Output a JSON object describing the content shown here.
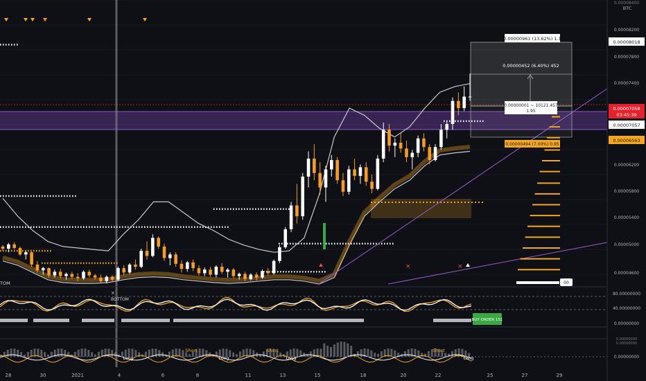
{
  "header": {
    "symbol": "BTC",
    "top_price": "0.00008400"
  },
  "colors": {
    "background": "#0f1015",
    "bull": "#ffffff",
    "bear": "#f39c2b",
    "orange": "#f5a623",
    "purple_zone": "#6b3fa0",
    "price_red": "#e5212b",
    "green": "#3aa845",
    "grid": "#1b1d24"
  },
  "price_axis": {
    "ticks": [
      "0.00008200",
      "0.00007800",
      "0.00007400",
      "0.00006200",
      "0.00005800",
      "0.00005400",
      "0.00005000",
      "0.00004600"
    ],
    "labels": {
      "high": "0.00008018",
      "current": "0.00007058",
      "countdown": "03:45:39",
      "level": "0.00007057",
      "entry": "0.00006563"
    }
  },
  "time_axis": [
    "28",
    "30",
    "2021",
    "4",
    "6",
    "8",
    "11",
    "13",
    "15",
    "18",
    "20",
    "22",
    "25",
    "27",
    "29"
  ],
  "annotations": {
    "measure_top": "0.00000961 (13.62%) 1.1",
    "measure_mid": "0.00000452 (6.40%) 452",
    "measure_cur_line1": "0.00000001 ~ 10121.457",
    "measure_cur_line2": "1.95",
    "measure_low": "0.00000494 (7.00%) 0.95",
    "bottom_left": "TOM",
    "bottom_label": "BOTTOM",
    "buy_order": "BUY ORDER 151",
    "right_small": "00"
  },
  "osc_panel": {
    "ticks": [
      "80.00000000",
      "40.00000000",
      "0.00000000"
    ]
  },
  "vol_panel": {
    "ticks": [
      "0.00000000"
    ],
    "short_labels": [
      "Short",
      "Short",
      "Short"
    ],
    "long_labels": [
      "Long",
      "Long",
      "Long",
      "Long"
    ]
  },
  "chart_data": {
    "type": "candlestick",
    "symbol": "BTC",
    "candles": [
      [
        4.98e-05,
        5e-05,
        4.92e-05,
        4.95e-05
      ],
      [
        4.95e-05,
        5.03e-05,
        4.9e-05,
        5.01e-05
      ],
      [
        5.01e-05,
        5.04e-05,
        4.94e-05,
        4.96e-05
      ],
      [
        4.96e-05,
        4.98e-05,
        4.85e-05,
        4.87e-05
      ],
      [
        4.87e-05,
        4.92e-05,
        4.8e-05,
        4.9e-05
      ],
      [
        4.9e-05,
        4.91e-05,
        4.7e-05,
        4.73e-05
      ],
      [
        4.73e-05,
        4.78e-05,
        4.62e-05,
        4.65e-05
      ],
      [
        4.65e-05,
        4.7e-05,
        4.59e-05,
        4.68e-05
      ],
      [
        4.68e-05,
        4.69e-05,
        4.55e-05,
        4.58e-05
      ],
      [
        4.58e-05,
        4.66e-05,
        4.55e-05,
        4.63e-05
      ],
      [
        4.63e-05,
        4.67e-05,
        4.54e-05,
        4.57e-05
      ],
      [
        4.57e-05,
        4.62e-05,
        4.52e-05,
        4.6e-05
      ],
      [
        4.6e-05,
        4.63e-05,
        4.53e-05,
        4.56e-05
      ],
      [
        4.56e-05,
        4.61e-05,
        4.5e-05,
        4.54e-05
      ],
      [
        4.54e-05,
        4.65e-05,
        4.52e-05,
        4.63e-05
      ],
      [
        4.63e-05,
        4.66e-05,
        4.55e-05,
        4.58e-05
      ],
      [
        4.58e-05,
        4.6e-05,
        4.52e-05,
        4.55e-05
      ],
      [
        4.55e-05,
        4.59e-05,
        4.48e-05,
        4.5e-05
      ],
      [
        4.5e-05,
        4.58e-05,
        4.47e-05,
        4.56e-05
      ],
      [
        4.56e-05,
        4.58e-05,
        4.49e-05,
        4.52e-05
      ],
      [
        4.52e-05,
        4.7e-05,
        4.5e-05,
        4.68e-05
      ],
      [
        4.68e-05,
        4.72e-05,
        4.58e-05,
        4.62e-05
      ],
      [
        4.62e-05,
        4.75e-05,
        4.6e-05,
        4.73e-05
      ],
      [
        4.73e-05,
        4.8e-05,
        4.66e-05,
        4.7e-05
      ],
      [
        4.7e-05,
        4.95e-05,
        4.68e-05,
        4.92e-05
      ],
      [
        4.92e-05,
        5.05e-05,
        4.8e-05,
        4.85e-05
      ],
      [
        4.85e-05,
        5.15e-05,
        4.83e-05,
        5.1e-05
      ],
      [
        5.1e-05,
        5.12e-05,
        4.95e-05,
        4.98e-05
      ],
      [
        4.98e-05,
        5.02e-05,
        4.78e-05,
        4.82e-05
      ],
      [
        4.82e-05,
        4.9e-05,
        4.72e-05,
        4.87e-05
      ],
      [
        4.87e-05,
        4.9e-05,
        4.7e-05,
        4.74e-05
      ],
      [
        4.74e-05,
        4.79e-05,
        4.62e-05,
        4.67e-05
      ],
      [
        4.67e-05,
        4.78e-05,
        4.63e-05,
        4.76e-05
      ],
      [
        4.76e-05,
        4.8e-05,
        4.64e-05,
        4.68e-05
      ],
      [
        4.68e-05,
        4.72e-05,
        4.58e-05,
        4.61e-05
      ],
      [
        4.61e-05,
        4.69e-05,
        4.57e-05,
        4.66e-05
      ],
      [
        4.66e-05,
        4.7e-05,
        4.56e-05,
        4.59e-05
      ],
      [
        4.59e-05,
        4.72e-05,
        4.55e-05,
        4.7e-05
      ],
      [
        4.7e-05,
        4.75e-05,
        4.6e-05,
        4.63e-05
      ],
      [
        4.63e-05,
        4.68e-05,
        4.55e-05,
        4.66e-05
      ],
      [
        4.66e-05,
        4.68e-05,
        4.54e-05,
        4.57e-05
      ],
      [
        4.57e-05,
        4.62e-05,
        4.52e-05,
        4.6e-05
      ],
      [
        4.6e-05,
        4.63e-05,
        4.5e-05,
        4.53e-05
      ],
      [
        4.53e-05,
        4.61e-05,
        4.51e-05,
        4.59e-05
      ],
      [
        4.59e-05,
        4.62e-05,
        4.51e-05,
        4.55e-05
      ],
      [
        4.55e-05,
        4.66e-05,
        4.53e-05,
        4.64e-05
      ],
      [
        4.64e-05,
        4.68e-05,
        4.58e-05,
        4.61e-05
      ],
      [
        4.61e-05,
        4.8e-05,
        4.59e-05,
        4.78e-05
      ],
      [
        4.78e-05,
        5e-05,
        4.75e-05,
        4.97e-05
      ],
      [
        4.97e-05,
        5.25e-05,
        4.95e-05,
        5.22e-05
      ],
      [
        5.22e-05,
        5.6e-05,
        5.18e-05,
        5.55e-05
      ],
      [
        5.55e-05,
        5.85e-05,
        5.3e-05,
        5.4e-05
      ],
      [
        5.4e-05,
        6e-05,
        5.35e-05,
        5.95e-05
      ],
      [
        5.95e-05,
        6.3e-05,
        5.8e-05,
        6.2e-05
      ],
      [
        6.2e-05,
        6.4e-05,
        5.9e-05,
        6e-05
      ],
      [
        6e-05,
        6.15e-05,
        5.7e-05,
        5.8e-05
      ],
      [
        5.8e-05,
        6.1e-05,
        5.6e-05,
        6.05e-05
      ],
      [
        6.05e-05,
        6.25e-05,
        5.95e-05,
        6.18e-05
      ],
      [
        6.18e-05,
        6.22e-05,
        5.85e-05,
        5.9e-05
      ],
      [
        5.9e-05,
        6e-05,
        5.68e-05,
        5.74e-05
      ],
      [
        5.74e-05,
        6.1e-05,
        5.7e-05,
        6.05e-05
      ],
      [
        6.05e-05,
        6.2e-05,
        5.9e-05,
        5.96e-05
      ],
      [
        5.96e-05,
        6.12e-05,
        5.85e-05,
        6.08e-05
      ],
      [
        6.08e-05,
        6.15e-05,
        5.82e-05,
        5.88e-05
      ],
      [
        5.88e-05,
        5.98e-05,
        5.72e-05,
        5.78e-05
      ],
      [
        5.78e-05,
        6.25e-05,
        5.76e-05,
        6.2e-05
      ],
      [
        6.2e-05,
        6.7e-05,
        6.15e-05,
        6.6e-05
      ],
      [
        6.6e-05,
        6.68e-05,
        6.3e-05,
        6.38e-05
      ],
      [
        6.38e-05,
        6.48e-05,
        6.22e-05,
        6.42e-05
      ],
      [
        6.42e-05,
        6.55e-05,
        6.28e-05,
        6.34e-05
      ],
      [
        6.34e-05,
        6.45e-05,
        6.15e-05,
        6.22e-05
      ],
      [
        6.22e-05,
        6.32e-05,
        6.05e-05,
        6.28e-05
      ],
      [
        6.28e-05,
        6.52e-05,
        6.22e-05,
        6.48e-05
      ],
      [
        6.48e-05,
        6.55e-05,
        6.3e-05,
        6.36e-05
      ],
      [
        6.36e-05,
        6.4e-05,
        6.12e-05,
        6.18e-05
      ],
      [
        6.18e-05,
        6.4e-05,
        6.16e-05,
        6.36e-05
      ],
      [
        6.36e-05,
        6.68e-05,
        6.32e-05,
        6.6e-05
      ],
      [
        6.6e-05,
        6.72e-05,
        6.48e-05,
        6.68e-05
      ],
      [
        6.68e-05,
        7.05e-05,
        6.6e-05,
        7e-05
      ],
      [
        7e-05,
        7.12e-05,
        6.8e-05,
        6.9e-05
      ],
      [
        6.9e-05,
        7.2e-05,
        6.86e-05,
        7.06e-05
      ],
      [
        7.06e-05,
        7.38e-05,
        7e-05,
        7.06e-05
      ]
    ],
    "bollinger_upper": [
      5.65e-05,
      5.4e-05,
      5.2e-05,
      5.05e-05,
      4.98e-05,
      4.96e-05,
      4.94e-05,
      4.92e-05,
      5.15e-05,
      5.35e-05,
      5.6e-05,
      5.6e-05,
      5.45e-05,
      5.3e-05,
      5.2e-05,
      5.08e-05,
      5e-05,
      4.94e-05,
      4.9e-05,
      4.92e-05,
      5.1e-05,
      5.7e-05,
      6.5e-05,
      6.9e-05,
      6.8e-05,
      6.62e-05,
      6.5e-05,
      6.64e-05,
      6.9e-05,
      7.12e-05,
      7.2e-05,
      7.24e-05
    ],
    "bollinger_lower": [
      4.78e-05,
      4.72e-05,
      4.62e-05,
      4.52e-05,
      4.48e-05,
      4.47e-05,
      4.47e-05,
      4.48e-05,
      4.52e-05,
      4.55e-05,
      4.56e-05,
      4.55e-05,
      4.52e-05,
      4.5e-05,
      4.48e-05,
      4.47e-05,
      4.48e-05,
      4.5e-05,
      4.52e-05,
      4.52e-05,
      4.5e-05,
      4.46e-05,
      4.55e-05,
      5e-05,
      5.4e-05,
      5.6e-05,
      5.78e-05,
      5.9e-05,
      6.1e-05,
      6.25e-05,
      6.28e-05,
      6.3e-05
    ],
    "dotted_levels": [
      7.78e-05,
      5.68e-05,
      5.5e-05,
      5.25e-05,
      5.02e-05,
      4.92e-05,
      4.75e-05,
      4.63e-05,
      6.72e-05
    ],
    "zones": {
      "purple": [
        6.76e-05,
        6.93e-05
      ],
      "orange": [
        5.52e-05,
        5.9e-05
      ]
    },
    "forecast_levels": [
      6.78e-05,
      6.64e-05,
      6.49e-05,
      6.32e-05,
      6.17e-05,
      6.02e-05,
      5.86e-05,
      5.71e-05,
      5.56e-05,
      5.41e-05,
      5.26e-05,
      5.11e-05,
      4.96e-05,
      4.81e-05,
      4.66e-05
    ],
    "time_ticks": [
      "28",
      "30",
      "2021",
      "4",
      "6",
      "8",
      "11",
      "13",
      "15",
      "18",
      "20",
      "22",
      "25",
      "27",
      "29"
    ],
    "oscillator_levels": [
      "80.00000000",
      "40.00000000",
      "0.00000000"
    ]
  }
}
